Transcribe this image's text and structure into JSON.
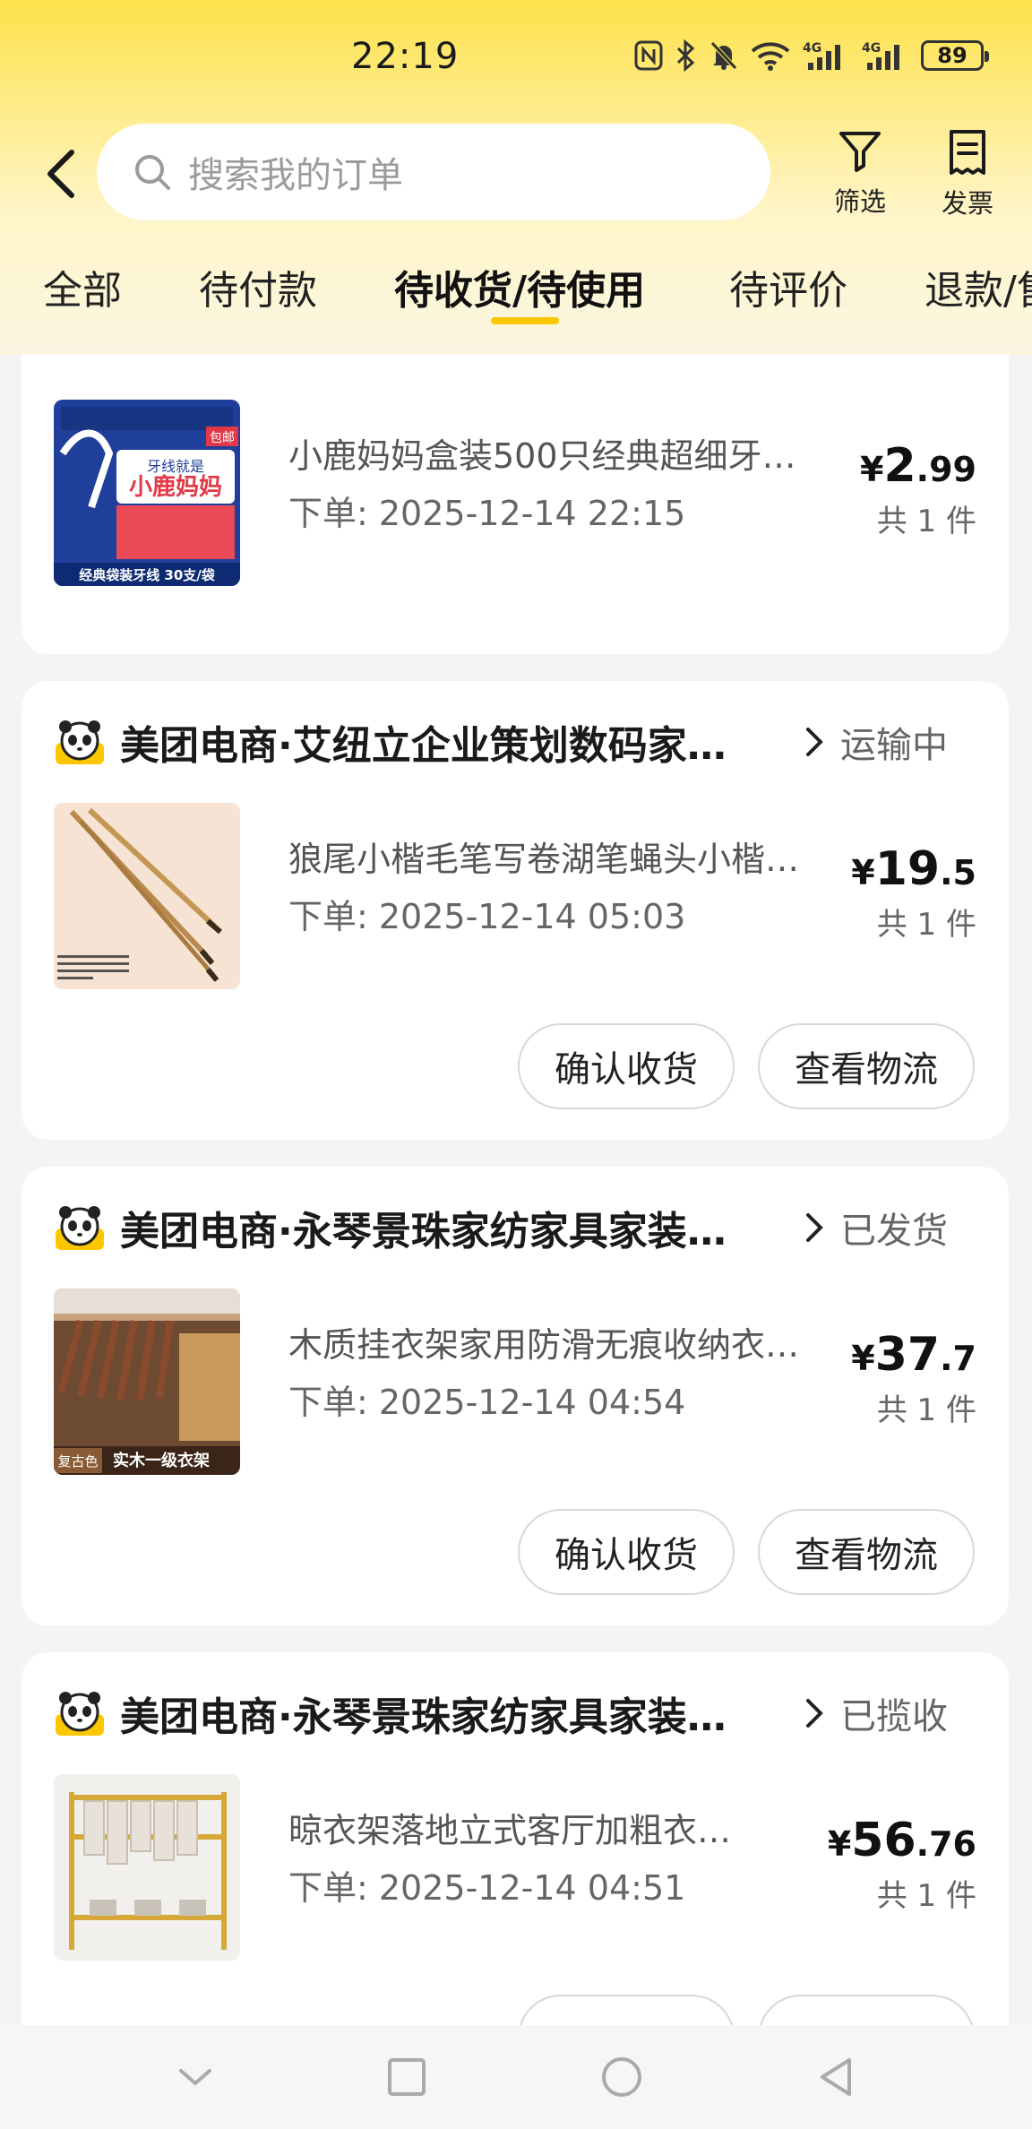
{
  "status_bar": {
    "time": "22:19",
    "battery": "89"
  },
  "search": {
    "placeholder": "搜索我的订单"
  },
  "actions": {
    "filter_label": "筛选",
    "invoice_label": "发票"
  },
  "tabs": [
    {
      "label": "全部"
    },
    {
      "label": "待付款"
    },
    {
      "label": "待收货/待使用",
      "active": true
    },
    {
      "label": "待评价"
    },
    {
      "label": "退款/售"
    }
  ],
  "orders": [
    {
      "product_title": "小鹿妈妈盒装500只经典超细牙…",
      "order_date": "下单: 2025-12-14 22:15",
      "price_currency": "¥",
      "price_int": "2",
      "price_dec": ".99",
      "quantity": "共 1 件",
      "thumb_text_top": "牙线就是",
      "thumb_brand": "小鹿妈妈",
      "thumb_caption": "经典袋装牙线 30支/袋",
      "thumb_badge": "包邮"
    },
    {
      "shop_name": "美团电商·艾纽立企业策划数码家…",
      "status": "运输中",
      "product_title": "狼尾小楷毛笔写卷湖笔蝇头小楷…",
      "order_date": "下单: 2025-12-14 05:03",
      "price_currency": "¥",
      "price_int": "19",
      "price_dec": ".5",
      "quantity": "共 1 件",
      "btn_confirm": "确认收货",
      "btn_logistics": "查看物流"
    },
    {
      "shop_name": "美团电商·永琴景珠家纺家具家装…",
      "status": "已发货",
      "product_title": "木质挂衣架家用防滑无痕收纳衣…",
      "order_date": "下单: 2025-12-14 04:54",
      "price_currency": "¥",
      "price_int": "37",
      "price_dec": ".7",
      "quantity": "共 1 件",
      "btn_confirm": "确认收货",
      "btn_logistics": "查看物流",
      "thumb_caption": "实木一级衣架",
      "thumb_color_label": "复古色"
    },
    {
      "shop_name": "美团电商·永琴景珠家纺家具家装…",
      "status": "已揽收",
      "product_title": "晾衣架落地立式客厅加粗衣…",
      "order_date": "下单: 2025-12-14 04:51",
      "price_currency": "¥",
      "price_int": "56",
      "price_dec": ".76",
      "quantity": "共 1 件"
    }
  ],
  "colors": {
    "accent": "#fdc700",
    "header_top": "#fde24a"
  }
}
